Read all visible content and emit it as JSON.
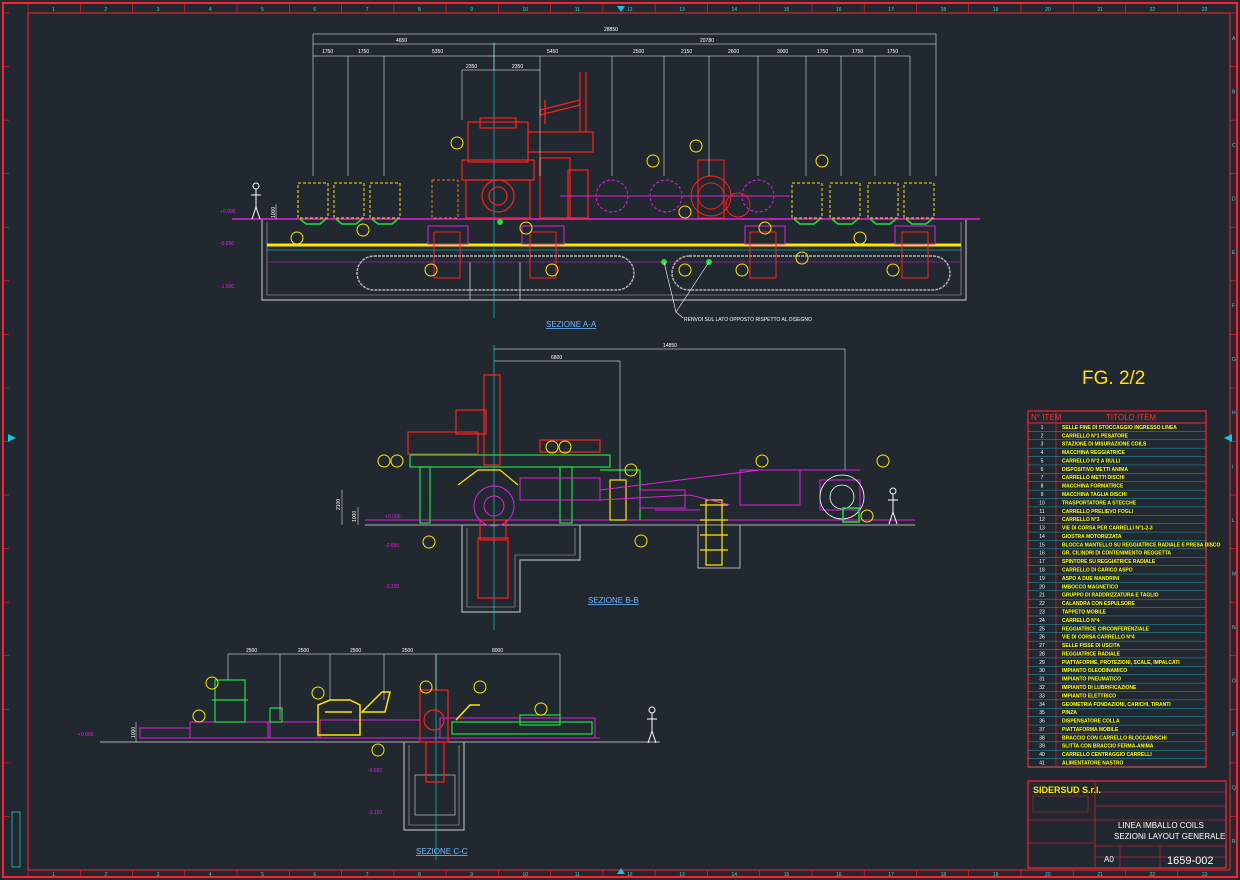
{
  "figure_label": "FG. 2/2",
  "sections": {
    "a": {
      "title": "SEZIONE A-A",
      "note": "RENVOI SUL LATO OPPOSTO RISPETTO AL DISEGNO"
    },
    "b": {
      "title": "SEZIONE B-B"
    },
    "c": {
      "title": "SEZIONE C-C"
    }
  },
  "dims_a": {
    "overall": "28850",
    "left": "4650",
    "right": "20780",
    "row": [
      "1750",
      "1750",
      "5350",
      "5450",
      "2500",
      "2150",
      "2600",
      "3000",
      "1750",
      "1750",
      "1750"
    ],
    "inner": [
      "2350",
      "2350"
    ],
    "height": "1000"
  },
  "dims_b": {
    "overall": "14850",
    "left": "6800",
    "height": "2100",
    "depth": "1000"
  },
  "dims_c": {
    "row": [
      "2500",
      "2500",
      "2500",
      "2500",
      "8000"
    ],
    "height": "1000"
  },
  "levels": [
    "+0.000",
    "-0.650",
    "-1.500",
    "-2.650",
    "-3.150"
  ],
  "border_numbers_top": [
    "1",
    "2",
    "3",
    "4",
    "5",
    "6",
    "7",
    "8",
    "9",
    "10",
    "11",
    "12",
    "13",
    "14",
    "15",
    "16",
    "17",
    "18",
    "19",
    "20",
    "21",
    "22",
    "23"
  ],
  "border_letters_side": [
    "A",
    "B",
    "C",
    "D",
    "E",
    "F",
    "G",
    "H",
    "I",
    "L",
    "M",
    "N",
    "O",
    "P",
    "Q",
    "R"
  ],
  "item_table": {
    "header_no": "N° ITEM",
    "header_title": "TITOLO ITEM",
    "items": [
      {
        "no": "1",
        "title": "SELLE FINE DI STOCCAGGIO INGRESSO LINEA"
      },
      {
        "no": "2",
        "title": "CARRELLO N°1 PESATORE"
      },
      {
        "no": "3",
        "title": "STAZIONE DI MISURAZIONE COILS"
      },
      {
        "no": "4",
        "title": "MACCHINA REGGIATRICE"
      },
      {
        "no": "5",
        "title": "CARRELLO N°2 A RULLI"
      },
      {
        "no": "6",
        "title": "DISPOSITIVO METTI ANIMA"
      },
      {
        "no": "7",
        "title": "CARRELLO METTI DISCHI"
      },
      {
        "no": "8",
        "title": "MACCHINA FORMATRICE"
      },
      {
        "no": "9",
        "title": "MACCHINA TAGLIA DISCHI"
      },
      {
        "no": "10",
        "title": "TRASPORTATORE A STECCHE"
      },
      {
        "no": "11",
        "title": "CARRELLO PRELIEVO FOGLI"
      },
      {
        "no": "12",
        "title": "CARRELLO N°3"
      },
      {
        "no": "13",
        "title": "VIE DI CORSA PER CARRELLI N°1-2-3"
      },
      {
        "no": "14",
        "title": "GIOSTRA MOTORIZZATA"
      },
      {
        "no": "15",
        "title": "BLOCCA MANTELLO SU REGGIATRICE RADIALE E PRESA DISCO"
      },
      {
        "no": "16",
        "title": "GR. CILINDRI DI CONTENIMENTO REGGETTA"
      },
      {
        "no": "17",
        "title": "SPINTORE SU REGGIATRICE RADIALE"
      },
      {
        "no": "18",
        "title": "CARRELLO DI CARICO ASPO"
      },
      {
        "no": "19",
        "title": "ASPO A DUE MANDRINI"
      },
      {
        "no": "20",
        "title": "IMBOCCO MAGNETICO"
      },
      {
        "no": "21",
        "title": "GRUPPO DI RADDRIZZATURA E TAGLIO"
      },
      {
        "no": "22",
        "title": "CALANDRA CON ESPULSORE"
      },
      {
        "no": "23",
        "title": "TAPPETO MOBILE"
      },
      {
        "no": "24",
        "title": "CARRELLO N°4"
      },
      {
        "no": "25",
        "title": "REGGIATRICE CIRCONFERENZIALE"
      },
      {
        "no": "26",
        "title": "VIE DI CORSA CARRELLO N°4"
      },
      {
        "no": "27",
        "title": "SELLE FISSE DI USCITA"
      },
      {
        "no": "28",
        "title": "REGGIATRICE RADIALE"
      },
      {
        "no": "29",
        "title": "PIATTAFORME, PROTEZIONI, SCALE, IMPALCATI"
      },
      {
        "no": "30",
        "title": "IMPIANTO OLEODINAMICO"
      },
      {
        "no": "31",
        "title": "IMPIANTO PNEUMATICO"
      },
      {
        "no": "32",
        "title": "IMPIANTO DI LUBRIFICAZIONE"
      },
      {
        "no": "33",
        "title": "IMPIANTO ELETTRICO"
      },
      {
        "no": "34",
        "title": "GEOMETRIA FONDAZIONI, CARICHI, TIRANTI"
      },
      {
        "no": "35",
        "title": "PINZA"
      },
      {
        "no": "36",
        "title": "DISPENSATORE COLLA"
      },
      {
        "no": "37",
        "title": "PIATTAFORMA MOBILE"
      },
      {
        "no": "38",
        "title": "BRACCIO CON CARRELLO BLOCCADISCHI"
      },
      {
        "no": "39",
        "title": "SLITTA CON BRACCIO FERMA-ANIMA"
      },
      {
        "no": "40",
        "title": "CARRELLO CENTRAGGIO CARRELLI"
      },
      {
        "no": "41",
        "title": "ALIMENTATORE NASTRO"
      }
    ]
  },
  "title_block": {
    "company": "SIDERSUD S.r.l.",
    "title_line1": "LINEA IMBALLO COILS",
    "title_line2": "SEZIONI LAYOUT GENERALE",
    "format": "A0",
    "drawing_no": "1659-002"
  },
  "colors": {
    "background": "#212830",
    "border": "#ff2030",
    "magenta": "#e020e0",
    "green": "#20e040",
    "yellow": "#ffe600",
    "cyan": "#20e0e0",
    "white": "#ffffff",
    "gray": "#b0b0b0",
    "red": "#ff2020"
  }
}
